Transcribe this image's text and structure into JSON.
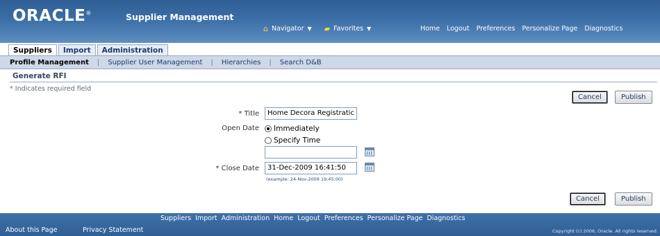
{
  "header": {
    "logo": "ORACLE",
    "logo_mark": "®",
    "app_title": "Supplier Management",
    "navigator_label": "Navigator",
    "favorites_label": "Favorites",
    "global_links": [
      "Home",
      "Logout",
      "Preferences",
      "Personalize Page",
      "Diagnostics"
    ]
  },
  "tabs": [
    {
      "label": "Suppliers",
      "active": true
    },
    {
      "label": "Import",
      "active": false
    },
    {
      "label": "Administration",
      "active": false
    }
  ],
  "subtabs": [
    {
      "label": "Profile Management",
      "active": true
    },
    {
      "label": "Supplier User Management",
      "active": false
    },
    {
      "label": "Hierarchies",
      "active": false
    },
    {
      "label": "Search D&B",
      "active": false
    }
  ],
  "page": {
    "title": "Generate RFI",
    "required_note": "* Indicates required field"
  },
  "buttons": {
    "cancel": "Cancel",
    "publish": "Publish"
  },
  "form": {
    "title_label": "* Title",
    "title_value": "Home Decora Registratic",
    "open_date_label": "Open Date",
    "immediately_label": "Immediately",
    "specify_time_label": "Specify Time",
    "open_date_value": "",
    "close_date_label": "* Close Date",
    "close_date_value": "31-Dec-2009 16:41:50",
    "close_date_example": "(example: 24-Nov-2009 19:45:00)"
  },
  "footer": {
    "links": [
      "Suppliers",
      "Import",
      "Administration",
      "Home",
      "Logout",
      "Preferences",
      "Personalize Page",
      "Diagnostics"
    ],
    "about": "About this Page",
    "privacy": "Privacy Statement",
    "copyright": "Copyright (c) 2006, Oracle. All rights reserved."
  },
  "colors": {
    "header_blue": "#3b6ea6",
    "subtab_bg": "#cdd8e8",
    "link_blue": "#1c3a6b"
  }
}
